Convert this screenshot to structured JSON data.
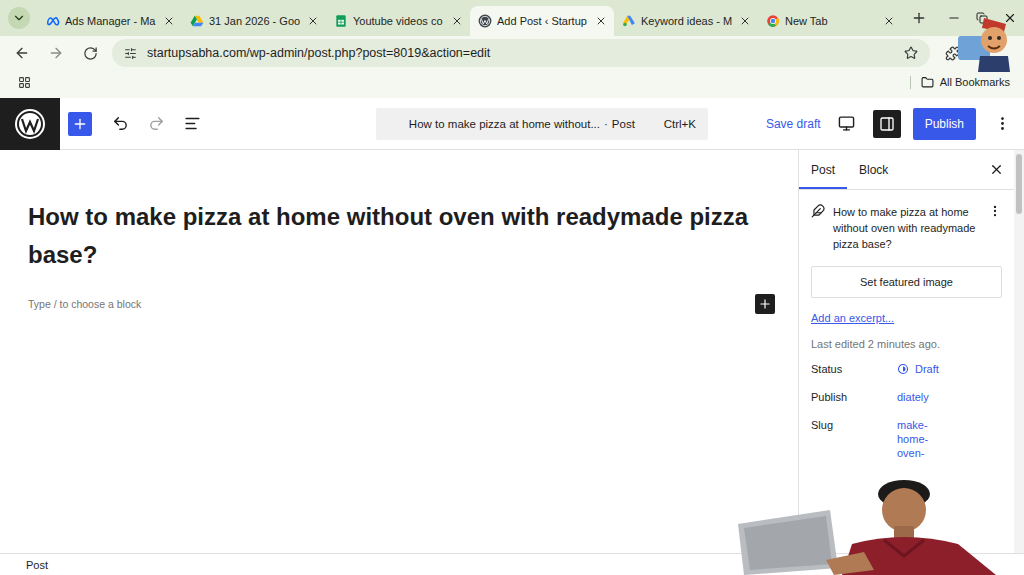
{
  "browser": {
    "tabs": [
      {
        "label": "Ads Manager - Ma",
        "selected": false,
        "kind": "meta"
      },
      {
        "label": "31 Jan 2026 - Goo",
        "selected": false,
        "kind": "drive"
      },
      {
        "label": "Youtube videos co",
        "selected": false,
        "kind": "sheets"
      },
      {
        "label": "Add Post ‹ Startup",
        "selected": true,
        "kind": "wordpress"
      },
      {
        "label": "Keyword ideas - M",
        "selected": false,
        "kind": "ads"
      },
      {
        "label": "New Tab",
        "selected": false,
        "kind": "chrome"
      }
    ],
    "address": "startupsabha.com/wp-admin/post.php?post=8019&action=edit",
    "bookmarks": {
      "folder": "All Bookmarks"
    }
  },
  "editor": {
    "history": {
      "undo_enabled": true,
      "redo_enabled": false
    },
    "command_bar": {
      "title": "How to make pizza at home without...",
      "separator": "·",
      "type": "Post",
      "shortcut": "Ctrl+K"
    },
    "save_draft": "Save draft",
    "sidebar_open": true,
    "publish": "Publish",
    "title": "How to make pizza at home without oven with readymade pizza base?",
    "placeholder": "Type / to choose a block"
  },
  "sidebar": {
    "tabs": [
      {
        "label": "Post",
        "selected": true
      },
      {
        "label": "Block",
        "selected": false
      }
    ],
    "post_title": "How to make pizza at home without oven with readymade pizza base?",
    "featured_image": "Set featured image",
    "excerpt": "Add an excerpt...",
    "last_edited": "Last edited 2 minutes ago.",
    "fields": [
      {
        "label": "Status",
        "value": "Draft",
        "kind": "status"
      },
      {
        "label": "Publish",
        "value": "diately",
        "kind": "link"
      },
      {
        "label": "Slug",
        "value": "make-home-oven-",
        "kind": "slug"
      }
    ]
  },
  "status_bar": {
    "breadcrumb": "Post"
  }
}
